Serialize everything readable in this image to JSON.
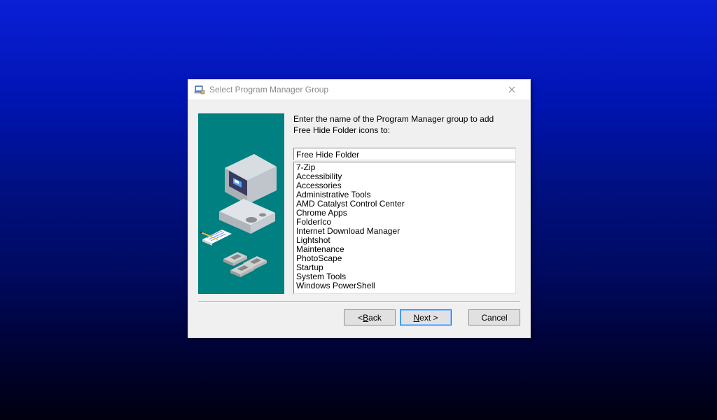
{
  "dialog": {
    "title": "Select Program Manager Group",
    "instruction": "Enter the name of the Program Manager group to add Free Hide Folder icons to:",
    "input_value": "Free Hide Folder",
    "list": [
      "7-Zip",
      "Accessibility",
      "Accessories",
      "Administrative Tools",
      "AMD Catalyst Control Center",
      "Chrome Apps",
      "FolderIco",
      "Internet Download Manager",
      "Lightshot",
      "Maintenance",
      "PhotoScape",
      "Startup",
      "System Tools",
      "Windows PowerShell"
    ],
    "buttons": {
      "back_prefix": "< ",
      "back_letter": "B",
      "back_rest": "ack",
      "next_letter": "N",
      "next_rest": "ext >",
      "cancel": "Cancel"
    }
  }
}
